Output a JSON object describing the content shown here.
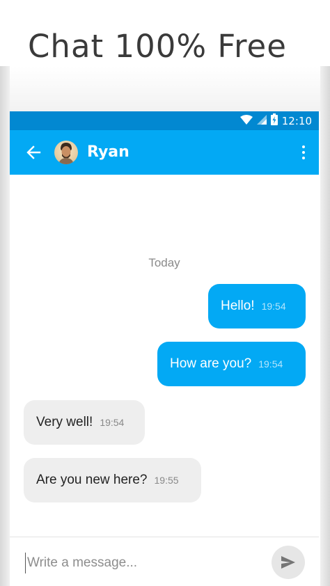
{
  "promo": {
    "title": "Chat 100% Free"
  },
  "status_bar": {
    "time": "12:10"
  },
  "header": {
    "contact_name": "Ryan"
  },
  "chat": {
    "date_separator": "Today",
    "messages": [
      {
        "direction": "outgoing",
        "text": "Hello!",
        "time": "19:54"
      },
      {
        "direction": "outgoing",
        "text": "How are you?",
        "time": "19:54"
      },
      {
        "direction": "incoming",
        "text": "Very well!",
        "time": "19:54"
      },
      {
        "direction": "incoming",
        "text": "Are you new here?",
        "time": "19:55"
      }
    ]
  },
  "composer": {
    "placeholder": "Write a message..."
  },
  "colors": {
    "status_bar": "#0288d1",
    "app_bar": "#03a9f4",
    "outgoing_bubble": "#03a9f4",
    "incoming_bubble": "#eeeeee"
  },
  "icons": {
    "back": "arrow-left-icon",
    "menu": "more-vert-icon",
    "send": "send-icon",
    "wifi": "wifi-icon",
    "signal": "signal-icon",
    "battery": "battery-charging-icon"
  }
}
